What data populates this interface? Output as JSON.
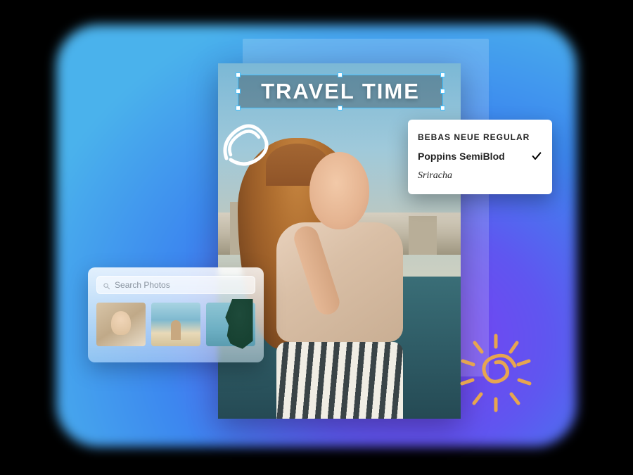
{
  "headline": {
    "text": "TRAVEL TIME"
  },
  "font_panel": {
    "options": [
      {
        "label": "BEBAS NEUE REGULAR",
        "selected": false
      },
      {
        "label": "Poppins SemiBlod",
        "selected": true
      },
      {
        "label": "Sriracha",
        "selected": false
      }
    ]
  },
  "search_panel": {
    "placeholder": "Search Photos",
    "thumbnails": [
      "portrait",
      "beach",
      "palm"
    ]
  },
  "decorations": {
    "scribble": "white-loop",
    "sun": "orange-sun-doodle"
  },
  "colors": {
    "selection": "#42c0ff",
    "sun_doodle": "#e6a550"
  }
}
